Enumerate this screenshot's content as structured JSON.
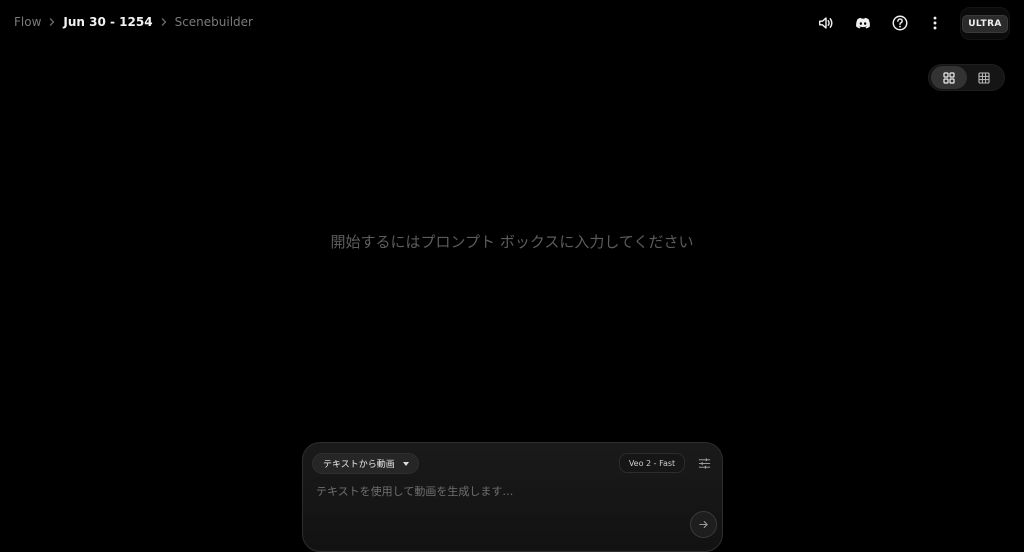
{
  "breadcrumb": {
    "items": [
      {
        "label": "Flow"
      },
      {
        "label": "Jun 30 - 1254"
      },
      {
        "label": "Scenebuilder"
      }
    ]
  },
  "header": {
    "icons": [
      "volume-icon",
      "discord-icon",
      "help-icon",
      "more-vertical-icon"
    ],
    "plan_badge": "ULTRA"
  },
  "view_toggle": {
    "active": "grid-large",
    "options": [
      "grid-large-icon",
      "grid-small-icon"
    ]
  },
  "empty_state": {
    "message": "開始するにはプロンプト ボックスに入力してください"
  },
  "prompt": {
    "mode_label": "テキストから動画",
    "model_label": "Veo 2 - Fast",
    "placeholder": "テキストを使用して動画を生成します…",
    "value": ""
  },
  "colors": {
    "background": "#000000",
    "panel": "#1a1a1a",
    "muted_text": "#5c5c5c"
  }
}
